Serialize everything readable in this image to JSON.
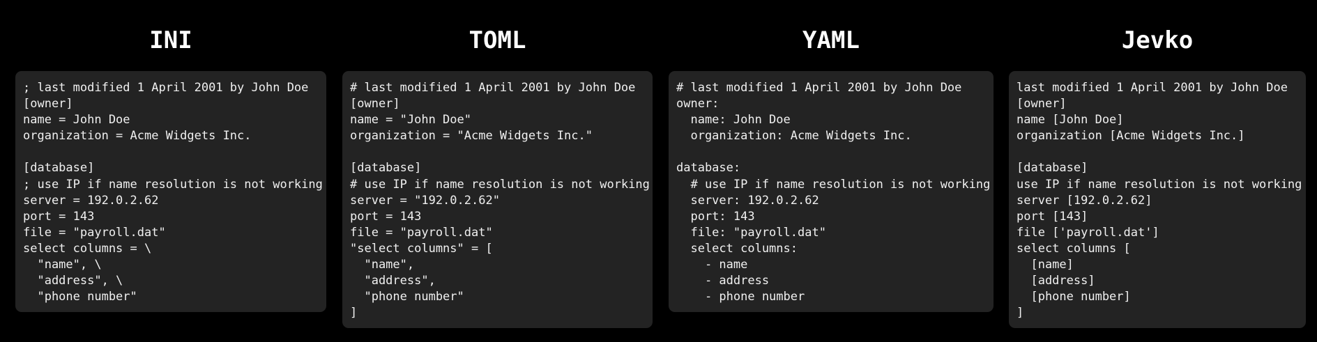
{
  "panels": [
    {
      "title": "INI",
      "code": "; last modified 1 April 2001 by John Doe\n[owner]\nname = John Doe\norganization = Acme Widgets Inc.\n\n[database]\n; use IP if name resolution is not working\nserver = 192.0.2.62\nport = 143\nfile = \"payroll.dat\"\nselect columns = \\\n  \"name\", \\\n  \"address\", \\\n  \"phone number\""
    },
    {
      "title": "TOML",
      "code": "# last modified 1 April 2001 by John Doe\n[owner]\nname = \"John Doe\"\norganization = \"Acme Widgets Inc.\"\n\n[database]\n# use IP if name resolution is not working\nserver = \"192.0.2.62\"\nport = 143\nfile = \"payroll.dat\"\n\"select columns\" = [\n  \"name\",\n  \"address\",\n  \"phone number\"\n]"
    },
    {
      "title": "YAML",
      "code": "# last modified 1 April 2001 by John Doe\nowner:\n  name: John Doe\n  organization: Acme Widgets Inc.\n\ndatabase:\n  # use IP if name resolution is not working\n  server: 192.0.2.62\n  port: 143\n  file: \"payroll.dat\"\n  select columns:\n    - name\n    - address\n    - phone number"
    },
    {
      "title": "Jevko",
      "code": "last modified 1 April 2001 by John Doe\n[owner]\nname [John Doe]\norganization [Acme Widgets Inc.]\n\n[database]\nuse IP if name resolution is not working\nserver [192.0.2.62]\nport [143]\nfile ['payroll.dat']\nselect columns [\n  [name]\n  [address]\n  [phone number]\n]"
    }
  ]
}
